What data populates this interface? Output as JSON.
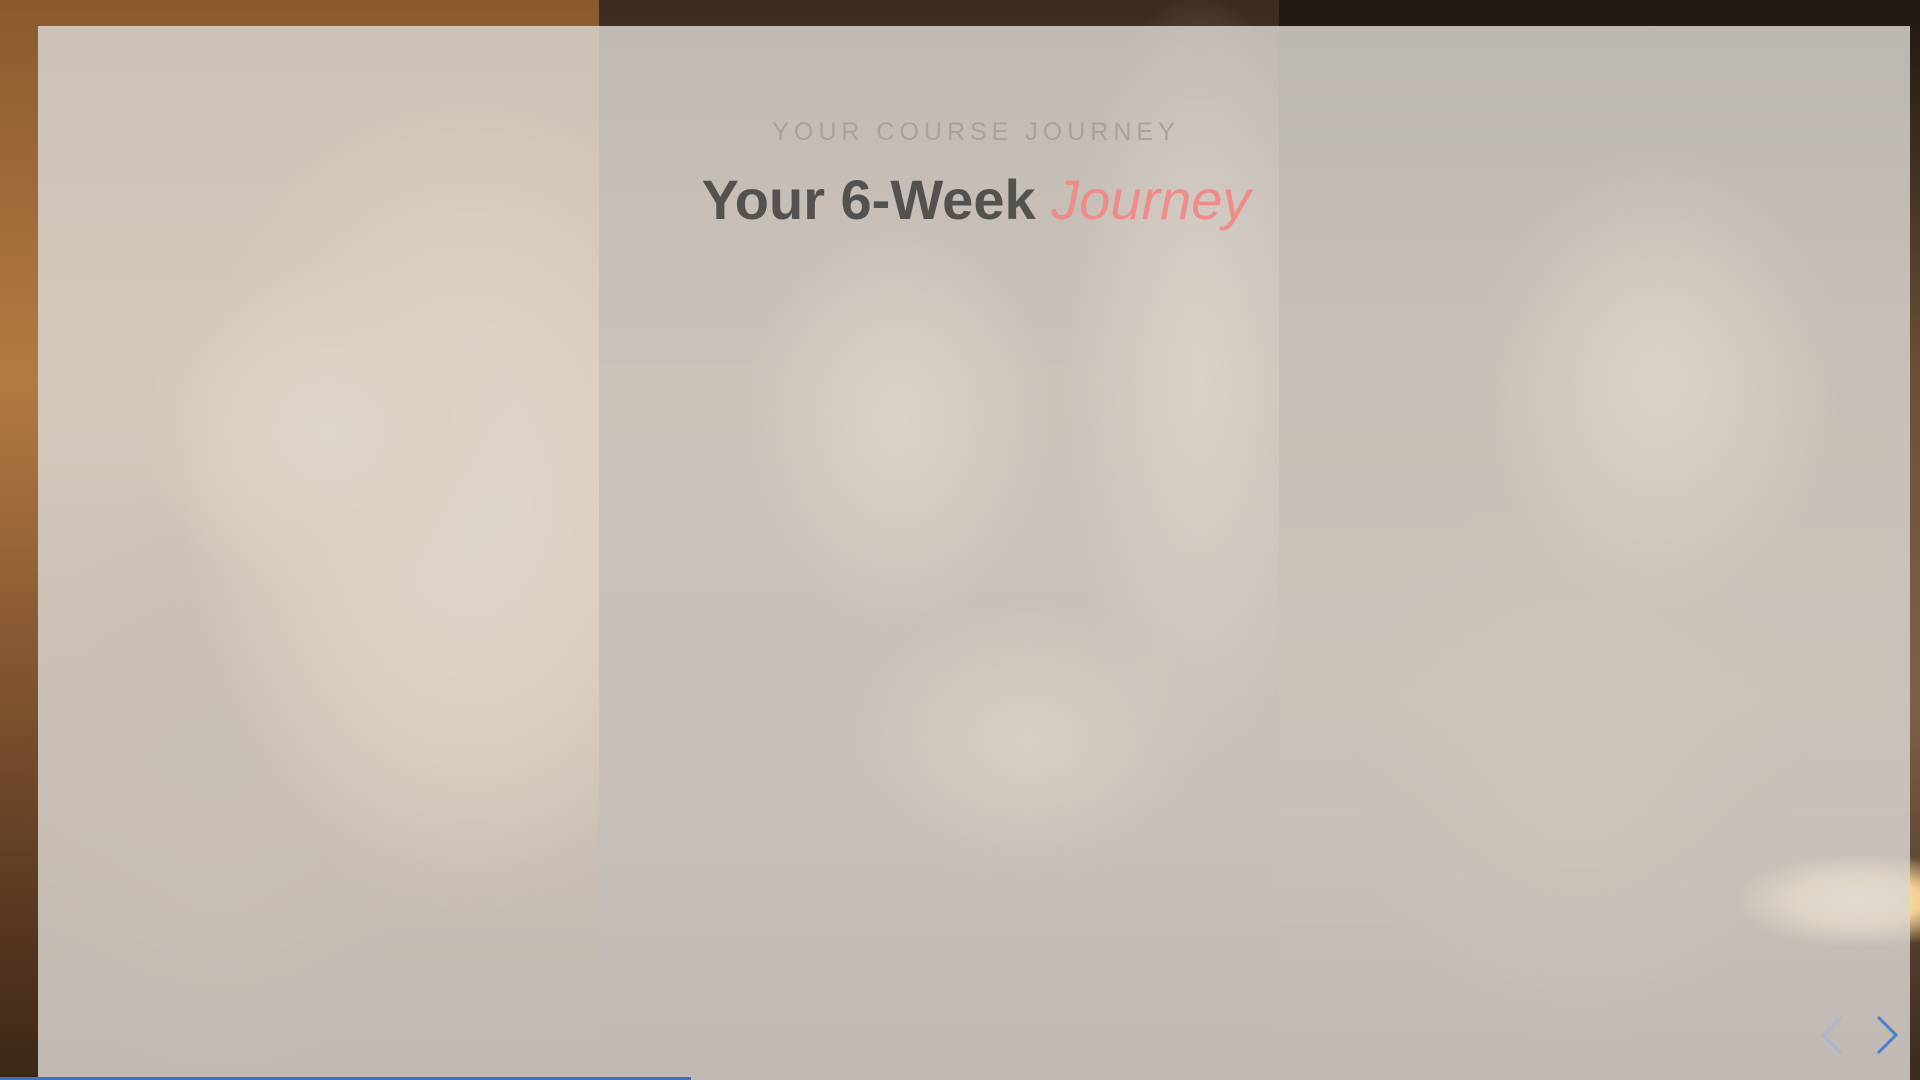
{
  "header": {
    "eyebrow": "YOUR COURSE JOURNEY",
    "title_main": "Your 6-Week ",
    "title_accent": "Journey"
  },
  "carousel": {
    "prev_icon": "chevron-left-icon",
    "next_icon": "chevron-right-icon",
    "progress_percent": 36
  },
  "colors": {
    "accent": "#f08b8b",
    "progress": "#3a72c4",
    "nav_prev": "#a9b6cf",
    "nav_next": "#4a7fd0"
  }
}
